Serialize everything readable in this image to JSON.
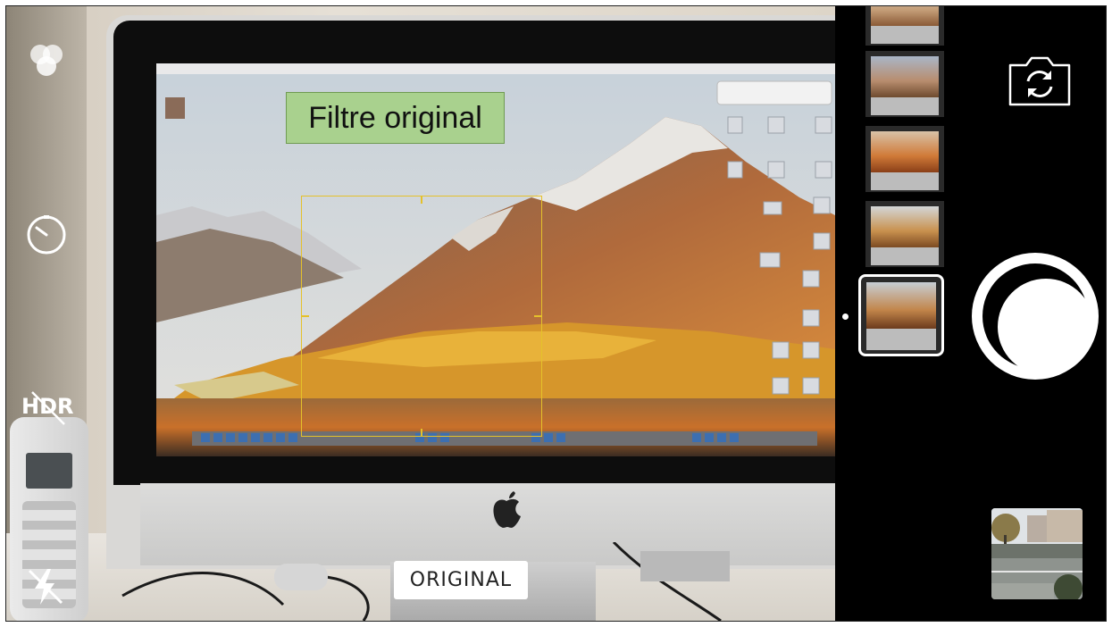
{
  "overlay": {
    "filter_caption": "Filtre original",
    "filter_pill": "ORIGINAL"
  },
  "left_controls": {
    "filters_icon": "three-circles-icon",
    "timer_icon": "timer-icon",
    "hdr_label": "HDR",
    "hdr_state": "off",
    "flash_icon": "flash-off-icon"
  },
  "right_controls": {
    "switch_camera_icon": "camera-switch-icon",
    "shutter_icon": "shutter-button",
    "last_photo_icon": "photo-thumbnail"
  },
  "filter_strip": {
    "thumbnail_count": 5,
    "selected_index": 4
  },
  "colors": {
    "focus_box": "#e5c12a",
    "caption_bg": "#a9d18e",
    "panel_bg": "#000000"
  }
}
